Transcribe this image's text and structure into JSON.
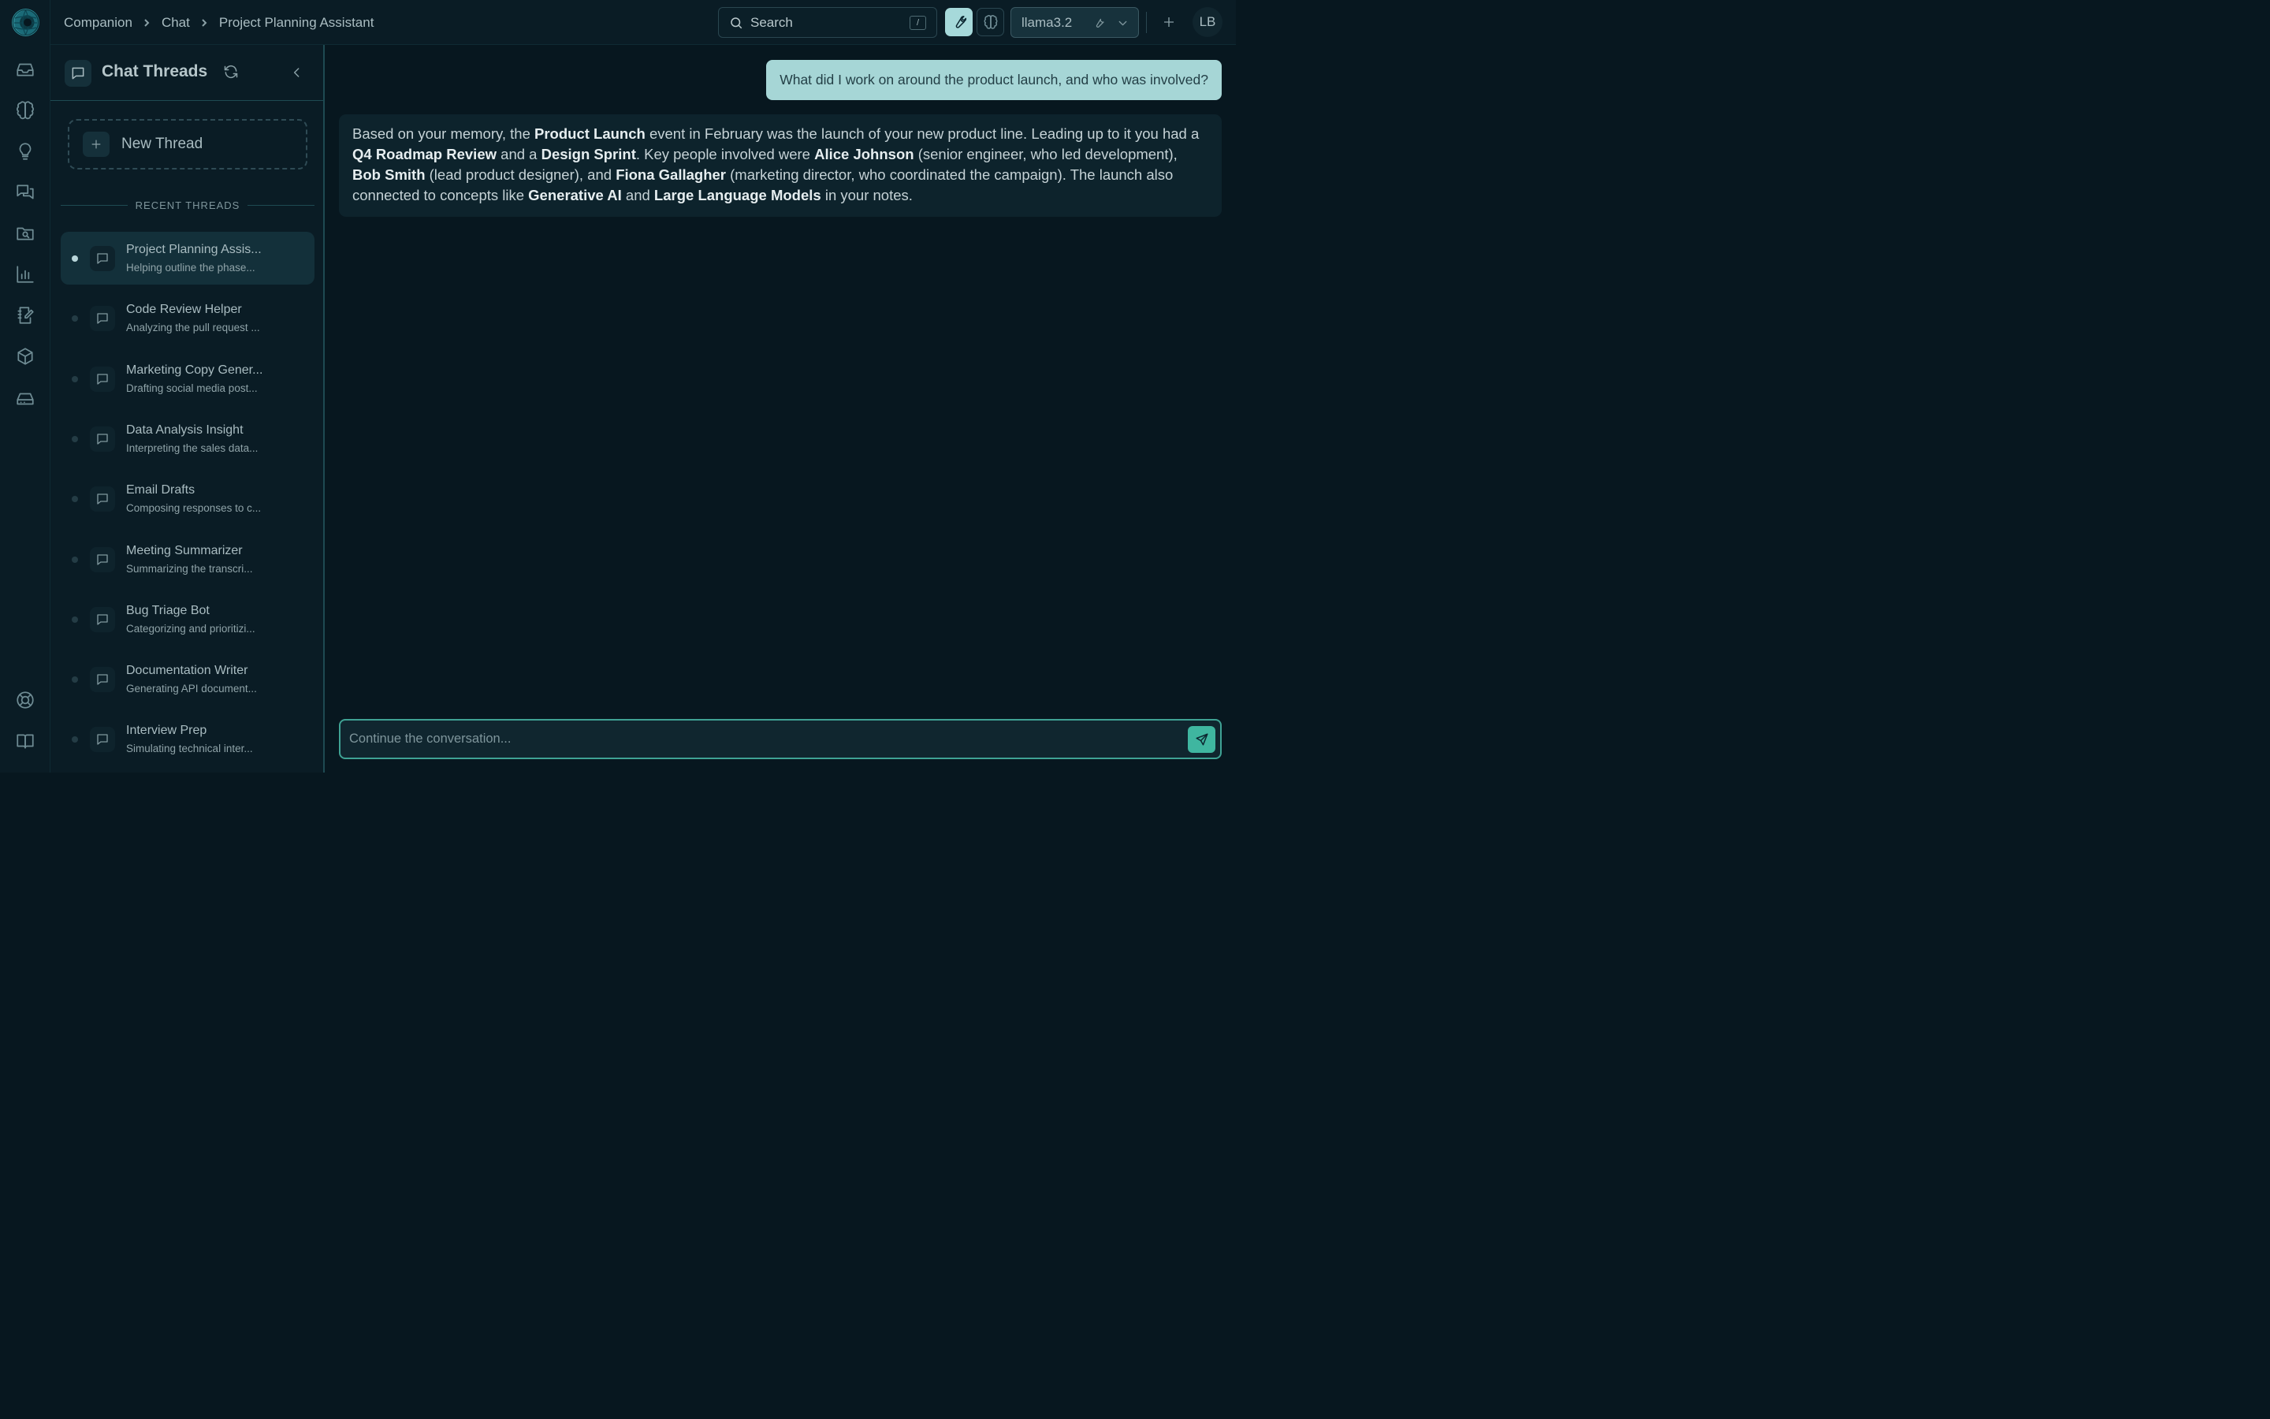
{
  "breadcrumb": [
    "Companion",
    "Chat",
    "Project Planning Assistant"
  ],
  "search": {
    "placeholder": "Search",
    "shortcut": "/"
  },
  "model": {
    "selected": "llama3.2"
  },
  "user": {
    "initials": "LB"
  },
  "rail": {
    "icons": [
      "inbox-icon",
      "brain-icon",
      "lightbulb-icon",
      "chats-icon",
      "folder-search-icon",
      "bar-chart-icon",
      "notebook-edit-icon",
      "package-icon",
      "drive-icon",
      "help-lifebuoy-icon",
      "book-icon"
    ]
  },
  "threads": {
    "title": "Chat Threads",
    "new_thread_label": "New Thread",
    "recent_label": "RECENT THREADS",
    "items": [
      {
        "title": "Project Planning Assis...",
        "subtitle": "Helping outline the phase...",
        "active": true
      },
      {
        "title": "Code Review Helper",
        "subtitle": "Analyzing the pull request ...",
        "active": false
      },
      {
        "title": "Marketing Copy Gener...",
        "subtitle": "Drafting social media post...",
        "active": false
      },
      {
        "title": "Data Analysis Insight",
        "subtitle": "Interpreting the sales data...",
        "active": false
      },
      {
        "title": "Email Drafts",
        "subtitle": "Composing responses to c...",
        "active": false
      },
      {
        "title": "Meeting Summarizer",
        "subtitle": "Summarizing the transcri...",
        "active": false
      },
      {
        "title": "Bug Triage Bot",
        "subtitle": "Categorizing and prioritizi...",
        "active": false
      },
      {
        "title": "Documentation Writer",
        "subtitle": "Generating API document...",
        "active": false
      },
      {
        "title": "Interview Prep",
        "subtitle": "Simulating technical inter...",
        "active": false
      }
    ]
  },
  "chat": {
    "user_message": "What did I work on around the product launch, and who was involved?",
    "assistant_message": {
      "parts": [
        {
          "text": "Based on your memory, the ",
          "bold": false
        },
        {
          "text": "Product Launch",
          "bold": true
        },
        {
          "text": " event in February was the launch of your new product line. Leading up to it you had a ",
          "bold": false
        },
        {
          "text": "Q4 Roadmap Review",
          "bold": true
        },
        {
          "text": " and a ",
          "bold": false
        },
        {
          "text": "Design Sprint",
          "bold": true
        },
        {
          "text": ". Key people involved were ",
          "bold": false
        },
        {
          "text": "Alice Johnson",
          "bold": true
        },
        {
          "text": " (senior engineer, who led development), ",
          "bold": false
        },
        {
          "text": "Bob Smith",
          "bold": true
        },
        {
          "text": " (lead product designer), and ",
          "bold": false
        },
        {
          "text": "Fiona Gallagher",
          "bold": true
        },
        {
          "text": " (marketing director, who coordinated the campaign). The launch also connected to concepts like ",
          "bold": false
        },
        {
          "text": "Generative AI",
          "bold": true
        },
        {
          "text": " and ",
          "bold": false
        },
        {
          "text": "Large Language Models",
          "bold": true
        },
        {
          "text": " in your notes.",
          "bold": false
        }
      ]
    },
    "composer_placeholder": "Continue the conversation..."
  },
  "colors": {
    "accent": "#3fb6a0",
    "user_bubble": "#a6d6d6",
    "background": "#07171f"
  }
}
